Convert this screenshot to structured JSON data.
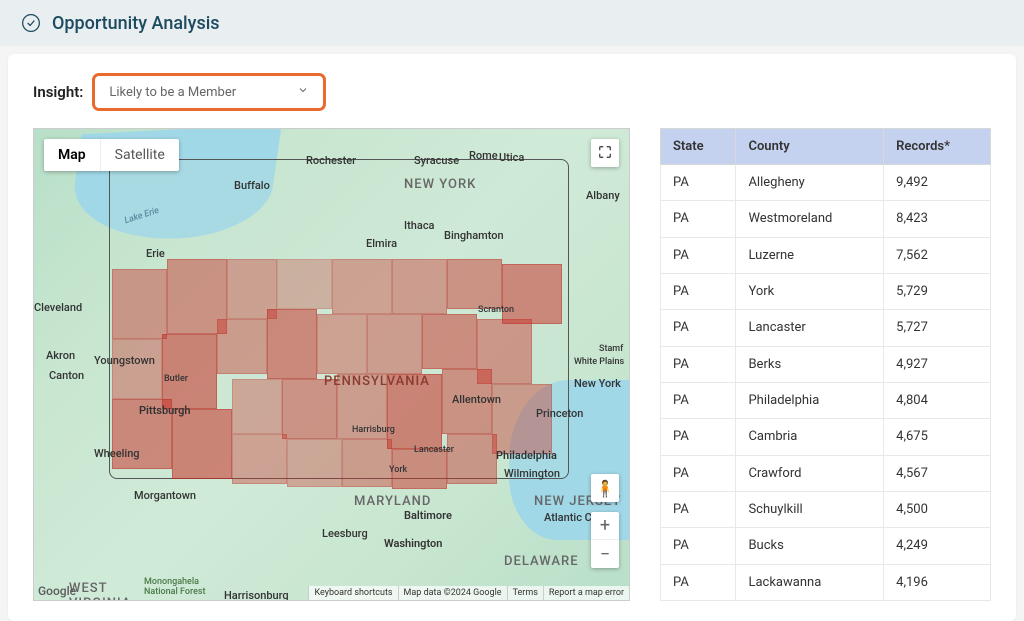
{
  "header": {
    "title": "Opportunity Analysis"
  },
  "insight": {
    "label": "Insight:",
    "selected": "Likely to be a Member"
  },
  "map": {
    "types": {
      "map": "Map",
      "satellite": "Satellite"
    },
    "footer": {
      "shortcuts": "Keyboard shortcuts",
      "attribution": "Map data ©2024 Google",
      "terms": "Terms",
      "report": "Report a map error"
    },
    "logo": "Google",
    "labels": {
      "newyork": "NEW YORK",
      "pennsylvania": "PENNSYLVANIA",
      "maryland": "MARYLAND",
      "newjersey": "NEW JERSEY",
      "delaware": "DELAWARE",
      "westvirginia": "WEST\nVIRGINIA",
      "buffalo": "Buffalo",
      "rochester": "Rochester",
      "syracuse": "Syracuse",
      "rome": "Rome",
      "utica": "Utica",
      "albany": "Albany",
      "ithaca": "Ithaca",
      "elmira": "Elmira",
      "binghamton": "Binghamton",
      "erie": "Erie",
      "cleveland": "Cleveland",
      "akron": "Akron",
      "canton": "Canton",
      "youngstown": "Youngstown",
      "pittsburgh": "Pittsburgh",
      "wheeling": "Wheeling",
      "morgantown": "Morgantown",
      "butler": "Butler",
      "harrisburg": "Harrisburg",
      "york": "York",
      "lancaster": "Lancaster",
      "scranton": "Scranton",
      "allentown": "Allentown",
      "philadelphia": "Philadelphia",
      "wilmington": "Wilmington",
      "princeton": "Princeton",
      "newyorkcity": "New York",
      "whiteplains": "White Plains",
      "stamford": "Stamf",
      "baltimore": "Baltimore",
      "washington": "Washington",
      "leesburg": "Leesburg",
      "harrisonburg": "Harrisonburg",
      "atlanticcity": "Atlantic City",
      "monongahela": "Monongahela\nNational Forest",
      "lakeerie": "Lake Erie"
    }
  },
  "table": {
    "headers": {
      "state": "State",
      "county": "County",
      "records": "Records*"
    },
    "rows": [
      {
        "state": "PA",
        "county": "Allegheny",
        "records": "9,492"
      },
      {
        "state": "PA",
        "county": "Westmoreland",
        "records": "8,423"
      },
      {
        "state": "PA",
        "county": "Luzerne",
        "records": "7,562"
      },
      {
        "state": "PA",
        "county": "York",
        "records": "5,729"
      },
      {
        "state": "PA",
        "county": "Lancaster",
        "records": "5,727"
      },
      {
        "state": "PA",
        "county": "Berks",
        "records": "4,927"
      },
      {
        "state": "PA",
        "county": "Philadelphia",
        "records": "4,804"
      },
      {
        "state": "PA",
        "county": "Cambria",
        "records": "4,675"
      },
      {
        "state": "PA",
        "county": "Crawford",
        "records": "4,567"
      },
      {
        "state": "PA",
        "county": "Schuylkill",
        "records": "4,500"
      },
      {
        "state": "PA",
        "county": "Bucks",
        "records": "4,249"
      },
      {
        "state": "PA",
        "county": "Lackawanna",
        "records": "4,196"
      }
    ]
  }
}
